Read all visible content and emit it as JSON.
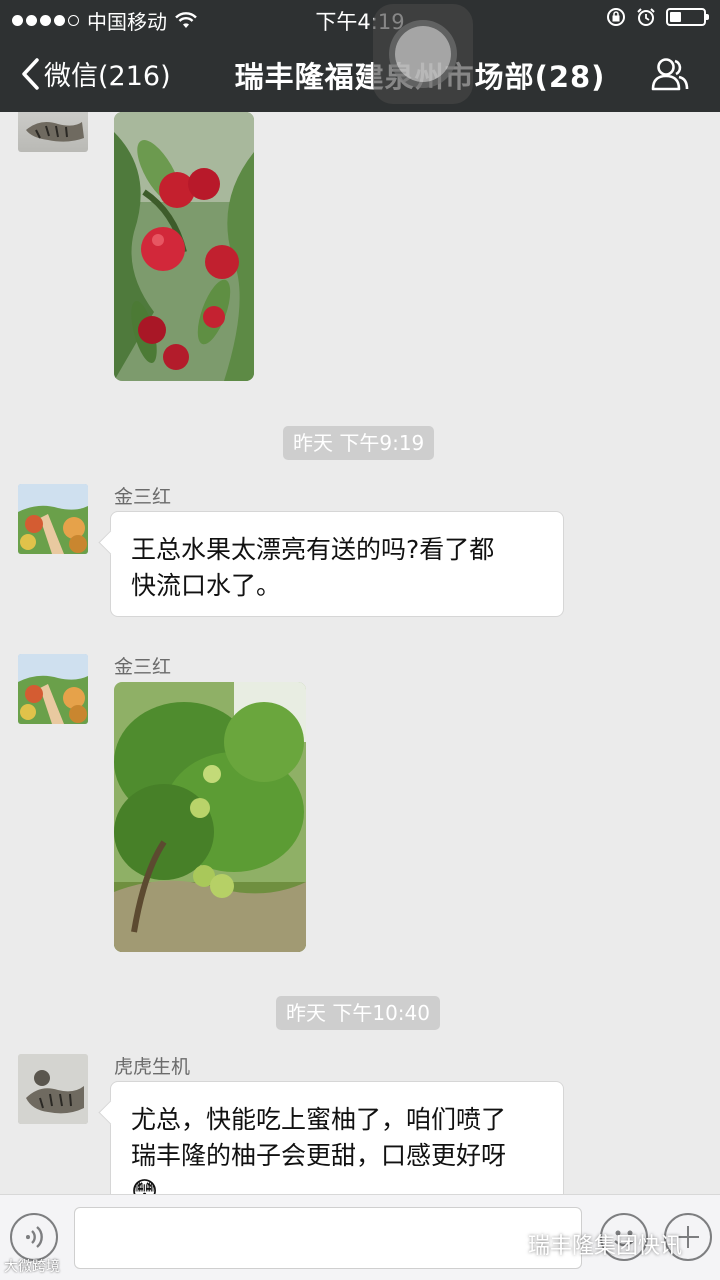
{
  "status_bar": {
    "carrier": "中国移动",
    "time": "下午4:19"
  },
  "nav": {
    "back_label": "微信(216)",
    "title": "瑞丰隆福建泉州市场部(28)"
  },
  "chat": {
    "timestamps": [
      "昨天 下午9:19",
      "昨天 下午10:40"
    ],
    "messages": [
      {
        "sender": "",
        "type": "image",
        "image_desc": "red-fruit-tree-photo"
      },
      {
        "sender": "金三红",
        "type": "text",
        "lines": [
          "王总水果太漂亮有送的吗?看了都",
          "快流口水了。"
        ]
      },
      {
        "sender": "金三红",
        "type": "image",
        "image_desc": "pomelo-tree-photo"
      },
      {
        "sender": "虎虎生机",
        "type": "text",
        "lines": [
          "尤总，快能吃上蜜柚了，咱们喷了",
          "瑞丰隆的柚子会更甜，口感更好呀"
        ],
        "emoji": "😳"
      }
    ]
  },
  "watermark": {
    "brand": "瑞丰隆集团快讯",
    "corner": "大微跨境"
  },
  "colors": {
    "nav_bg": "#2e3132",
    "chat_bg": "#ebebeb",
    "timestamp_bg": "#cecece"
  }
}
